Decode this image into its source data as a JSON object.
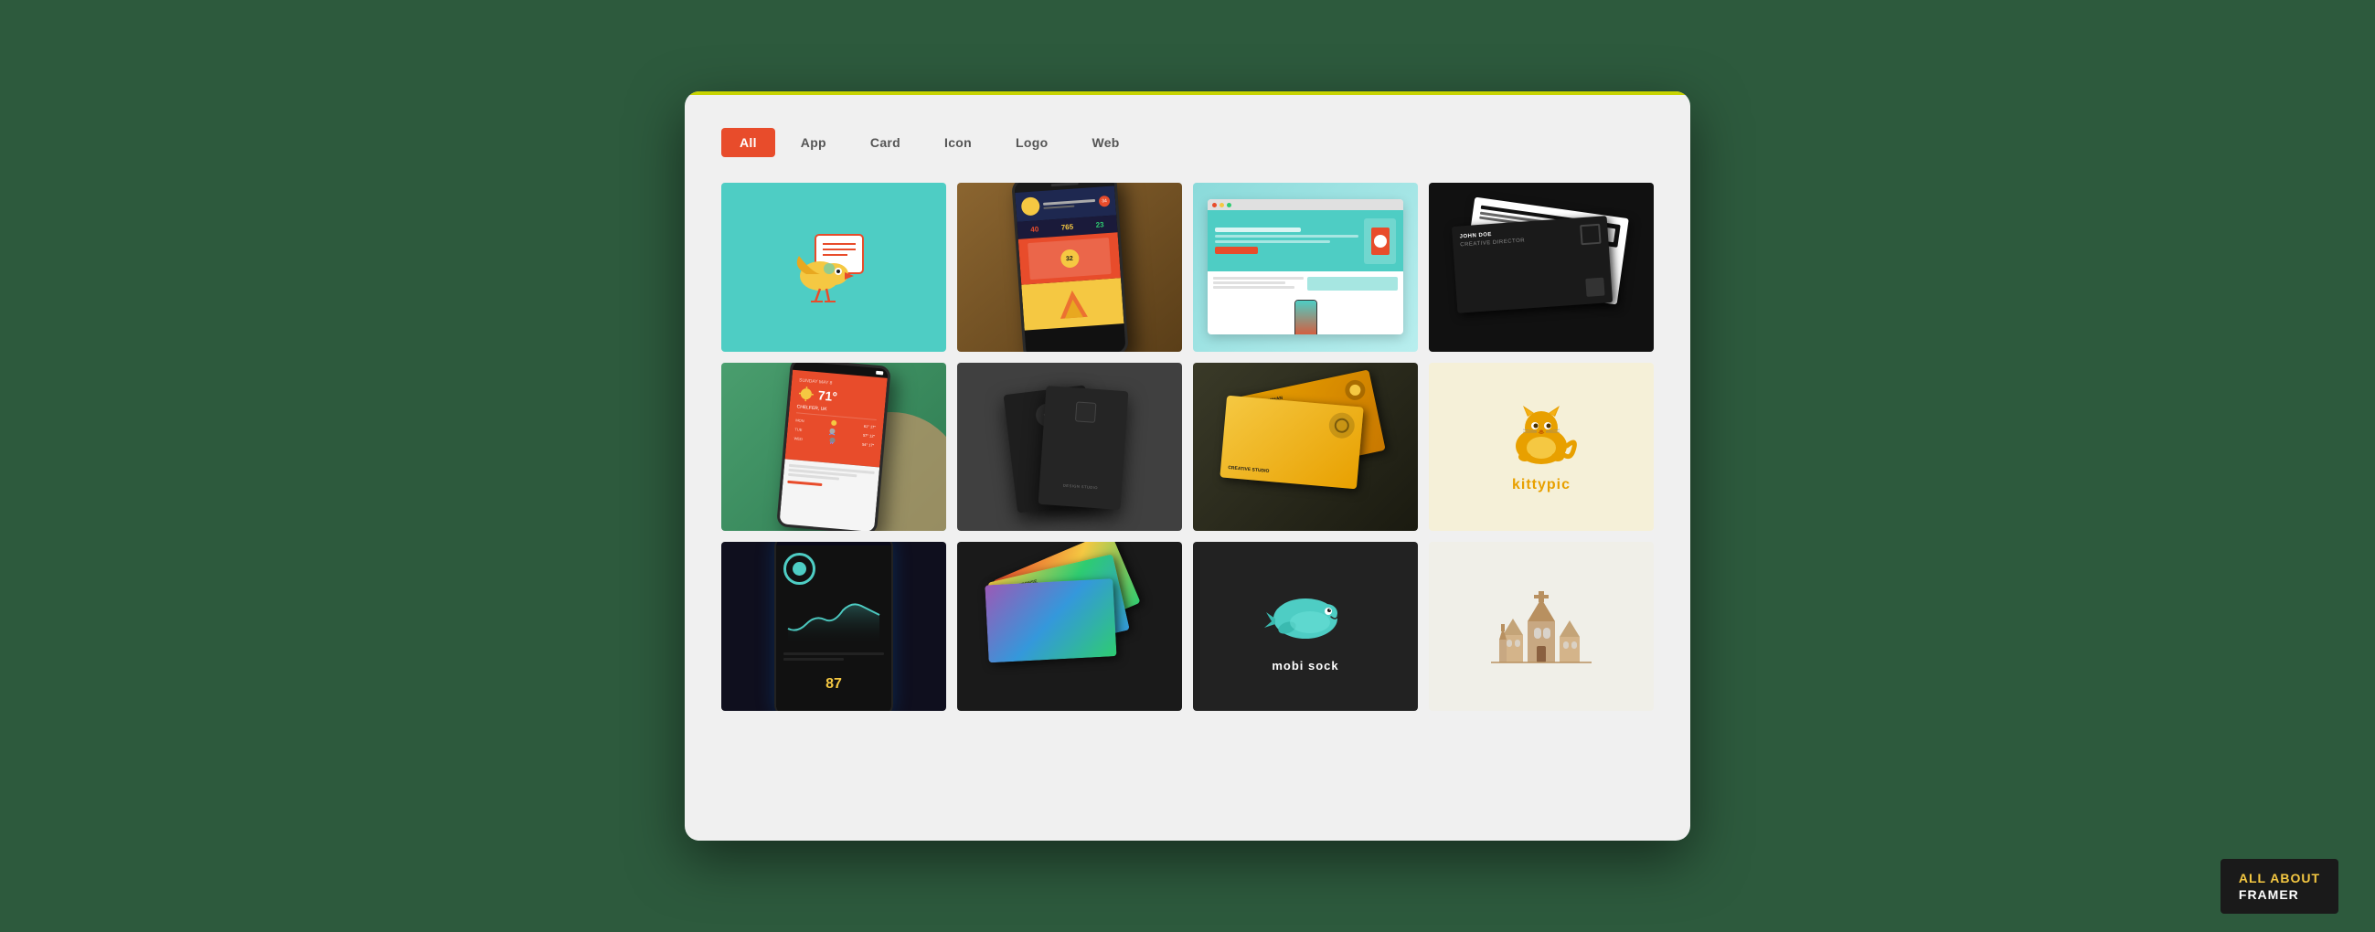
{
  "background_color": "#2d5a3d",
  "window": {
    "border_color": "#c8d400"
  },
  "nav": {
    "items": [
      {
        "label": "All",
        "active": true
      },
      {
        "label": "App",
        "active": false
      },
      {
        "label": "Card",
        "active": false
      },
      {
        "label": "Icon",
        "active": false
      },
      {
        "label": "Logo",
        "active": false
      },
      {
        "label": "Web",
        "active": false
      }
    ],
    "active_bg": "#e84c2b",
    "active_color": "#ffffff"
  },
  "grid": {
    "items": [
      {
        "id": 1,
        "type": "bird-icon",
        "bg": "#4ecdc4",
        "row": 1
      },
      {
        "id": 2,
        "type": "phone-app",
        "bg": "#7a5c2e",
        "row": 1
      },
      {
        "id": 3,
        "type": "web-design",
        "bg": "#7dd4d4",
        "row": 1
      },
      {
        "id": 4,
        "type": "biz-cards-black",
        "bg": "#111111",
        "row": 1
      },
      {
        "id": 5,
        "type": "weather-phone",
        "bg": "#3d9c6b",
        "row": 2
      },
      {
        "id": 6,
        "type": "dark-notebooks",
        "bg": "#3d3d3d",
        "row": 2
      },
      {
        "id": 7,
        "type": "gold-biz-cards",
        "bg": "#4a4a30",
        "row": 2
      },
      {
        "id": 8,
        "type": "kitty-logo",
        "bg": "#f5f0d8",
        "row": 2
      },
      {
        "id": 9,
        "type": "dark-phone-app",
        "bg": "#111122",
        "row": 3
      },
      {
        "id": 10,
        "type": "colorful-cards",
        "bg": "#1a1a1a",
        "row": 3
      },
      {
        "id": 11,
        "type": "mobi-sock",
        "bg": "#222222",
        "row": 3
      },
      {
        "id": 12,
        "type": "church-logo",
        "bg": "#f0efe8",
        "row": 3
      }
    ]
  },
  "brand": {
    "line1": "ALL ABOUT",
    "line2": "FRAMER",
    "bg": "#1a1a1a",
    "color1": "#f5c842",
    "color2": "#ffffff"
  }
}
